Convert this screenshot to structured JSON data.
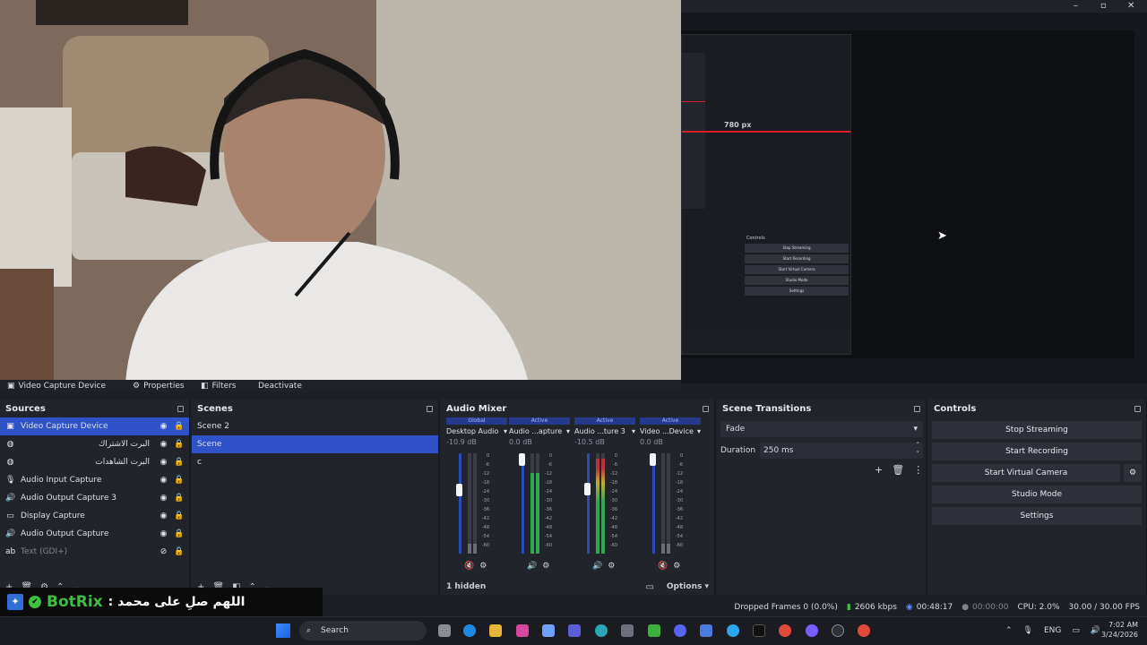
{
  "colors": {
    "accent": "#2f52c9",
    "meter_green": "#2fa84f",
    "meter_red": "#c0303a",
    "bot_green": "#3fbf3f"
  },
  "preview": {
    "nested_label": "780 px",
    "nested_controls": [
      "Stop Streaming",
      "Start Recording",
      "Start Virtual Camera",
      "Studio Mode",
      "Settings"
    ],
    "nested_controls_title": "Controls"
  },
  "toolbar": {
    "source_name": "Video Capture Device",
    "properties": "Properties",
    "filters": "Filters",
    "deactivate": "Deactivate"
  },
  "sources": {
    "title": "Sources",
    "items": [
      {
        "label": "Video Capture Device",
        "icon": "camera-icon",
        "selected": true
      },
      {
        "label": "البرت الاشتراك",
        "icon": "browser-icon",
        "rtl": true
      },
      {
        "label": "البرت الشاهدات",
        "icon": "browser-icon",
        "rtl": true
      },
      {
        "label": "Audio Input Capture",
        "icon": "microphone-icon"
      },
      {
        "label": "Audio Output Capture 3",
        "icon": "speaker-icon"
      },
      {
        "label": "Display Capture",
        "icon": "monitor-icon"
      },
      {
        "label": "Audio Output Capture",
        "icon": "speaker-icon"
      },
      {
        "label": "Text (GDI+)",
        "icon": "text-icon",
        "hidden": true
      }
    ]
  },
  "scenes": {
    "title": "Scenes",
    "items": [
      {
        "label": "Scene 2"
      },
      {
        "label": "Scene",
        "selected": true
      },
      {
        "label": "c"
      }
    ]
  },
  "mixer": {
    "title": "Audio Mixer",
    "hidden_label": "1 hidden",
    "options_label": "Options",
    "channels": [
      {
        "tag": "Global",
        "name": "Desktop Audio",
        "db": "-10.9 dB",
        "level": 0.65,
        "muted": true
      },
      {
        "tag": "Active",
        "name": "Audio ...apture",
        "db": "0.0 dB",
        "level": 1.0,
        "muted": false
      },
      {
        "tag": "Active",
        "name": "Audio ...ture 3",
        "db": "-10.5 dB",
        "level": 0.66,
        "muted": false
      },
      {
        "tag": "Active",
        "name": "Video ...Device",
        "db": "0.0 dB",
        "level": 1.0,
        "muted": true
      }
    ],
    "ticks": [
      "0",
      "-6",
      "-12",
      "-18",
      "-24",
      "-30",
      "-36",
      "-42",
      "-48",
      "-54",
      "-60"
    ]
  },
  "transitions": {
    "title": "Scene Transitions",
    "type": "Fade",
    "duration_label": "Duration",
    "duration_value": "250 ms"
  },
  "controls": {
    "title": "Controls",
    "buttons": [
      "Stop Streaming",
      "Start Recording",
      "Start Virtual Camera",
      "Studio Mode",
      "Settings"
    ]
  },
  "status": {
    "dropped": "Dropped Frames 0 (0.0%)",
    "bitrate": "2606 kbps",
    "stream_time": "00:48:17",
    "rec_time": "00:00:00",
    "cpu": "CPU: 2.0%",
    "fps": "30.00 / 30.00 FPS"
  },
  "chat": {
    "bot": "BotRix",
    "message": "اللهم صلِ على محمد :"
  },
  "taskbar": {
    "search": "Search",
    "lang": "ENG",
    "time": "7:02 AM",
    "date": "3/24/2026"
  }
}
